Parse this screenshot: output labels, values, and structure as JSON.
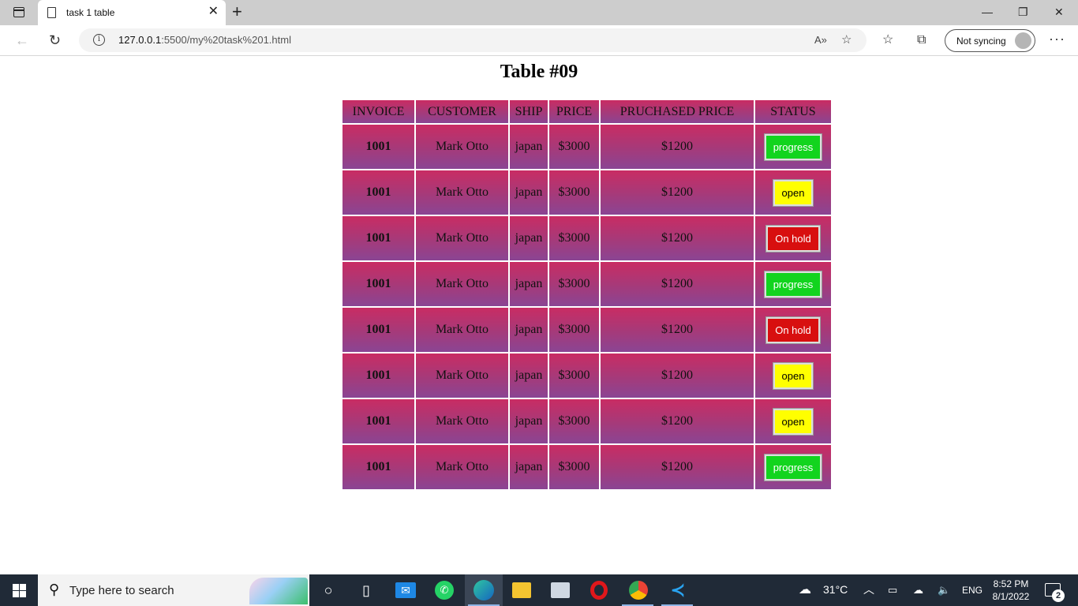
{
  "browser": {
    "tab_title": "task 1 table",
    "url_host": "127.0.0.1",
    "url_rest": ":5500/my%20task%201.html",
    "sync_label": "Not syncing"
  },
  "page": {
    "title": "Table #09",
    "columns": [
      "INVOICE",
      "CUSTOMER",
      "SHIP",
      "PRICE",
      "PRUCHASED PRICE",
      "STATUS"
    ],
    "rows": [
      {
        "invoice": "1001",
        "customer": "Mark Otto",
        "ship": "japan",
        "price": "$3000",
        "purchased": "$1200",
        "status": "progress",
        "status_color": "green"
      },
      {
        "invoice": "1001",
        "customer": "Mark Otto",
        "ship": "japan",
        "price": "$3000",
        "purchased": "$1200",
        "status": "open",
        "status_color": "yellow"
      },
      {
        "invoice": "1001",
        "customer": "Mark Otto",
        "ship": "japan",
        "price": "$3000",
        "purchased": "$1200",
        "status": "On hold",
        "status_color": "red"
      },
      {
        "invoice": "1001",
        "customer": "Mark Otto",
        "ship": "japan",
        "price": "$3000",
        "purchased": "$1200",
        "status": "progress",
        "status_color": "green"
      },
      {
        "invoice": "1001",
        "customer": "Mark Otto",
        "ship": "japan",
        "price": "$3000",
        "purchased": "$1200",
        "status": "On hold",
        "status_color": "red"
      },
      {
        "invoice": "1001",
        "customer": "Mark Otto",
        "ship": "japan",
        "price": "$3000",
        "purchased": "$1200",
        "status": "open",
        "status_color": "yellow"
      },
      {
        "invoice": "1001",
        "customer": "Mark Otto",
        "ship": "japan",
        "price": "$3000",
        "purchased": "$1200",
        "status": "open",
        "status_color": "yellow"
      },
      {
        "invoice": "1001",
        "customer": "Mark Otto",
        "ship": "japan",
        "price": "$3000",
        "purchased": "$1200",
        "status": "progress",
        "status_color": "green"
      }
    ]
  },
  "colors": {
    "row_gradient_top": "#c92c63",
    "row_gradient_bottom": "#8a4593",
    "status_green": "#12d41e",
    "status_yellow": "#ffff00",
    "status_red": "#d80f0f"
  },
  "taskbar": {
    "search_placeholder": "Type here to search",
    "temperature": "31°C",
    "language": "ENG",
    "time": "8:52 PM",
    "date": "8/1/2022",
    "notification_count": "2",
    "apps": [
      "cortana-icon",
      "task-view-icon",
      "mail-icon",
      "whatsapp-icon",
      "edge-icon",
      "file-explorer-icon",
      "network-app-icon",
      "opera-icon",
      "chrome-icon",
      "vscode-icon"
    ]
  }
}
